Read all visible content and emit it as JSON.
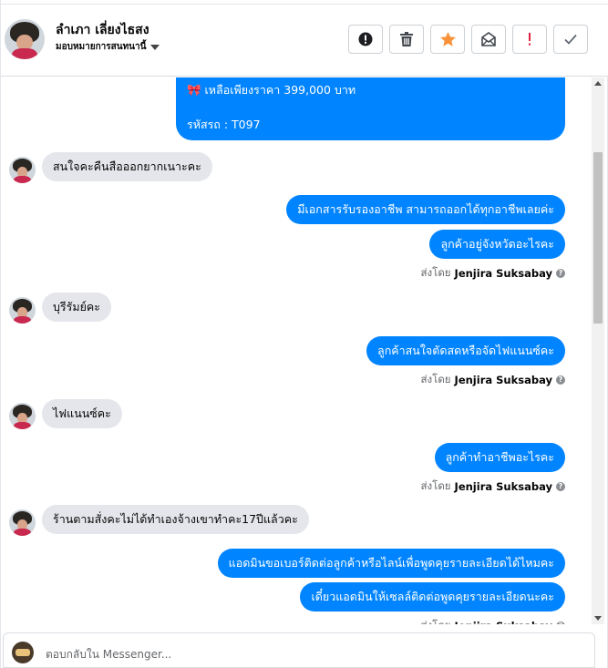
{
  "header": {
    "contact_name": "ลำเภา เลี่ยงไธสง",
    "assignment_label": "มอบหมายการสนทนานี้"
  },
  "toolbar": {
    "icons": [
      "alert-circle-icon",
      "trash-icon",
      "star-icon",
      "mail-icon",
      "exclamation-icon",
      "check-icon"
    ],
    "colors": {
      "star": "#f7923a",
      "exclamation": "#e41e3f",
      "icon": "#444950"
    }
  },
  "messages": [
    {
      "dir": "out",
      "lines": [
        "🎀 เหลือเพียงราคา 399,000 บาท",
        "",
        "รหัสรถ : T097"
      ]
    },
    {
      "dir": "in",
      "text": "สนใจคะคืนสือออกยากเนาะคะ"
    },
    {
      "dir": "out",
      "text": "มีเอกสารรับรองอาชีพ สามารถออกได้ทุกอาชีพเลยค่ะ"
    },
    {
      "dir": "out",
      "text": "ลูกค้าอยู่จังหวัดอะไรคะ"
    },
    {
      "dir": "in",
      "text": "บุรีรัมย์คะ"
    },
    {
      "dir": "out",
      "text": "ลูกค้าสนใจตัดสดหรือจัดไฟแนนซ์คะ"
    },
    {
      "dir": "in",
      "text": "ไฟแนนซ์คะ"
    },
    {
      "dir": "out",
      "text": "ลูกค้าทำอาชีพอะไรคะ"
    },
    {
      "dir": "in",
      "text": "ร้านตามสั่งคะไม่ได้ทำเองจ้างเขาทำคะ17ปีแล้วคะ"
    },
    {
      "dir": "out",
      "text": "แอดมินขอเบอร์ติดต่อลูกค้าหรือไลน์เพื่อพูดคุยรายละเอียดได้ไหมคะ"
    },
    {
      "dir": "out",
      "text": "เดี๋ยวแอดมินให้เซลล์ติดต่อพูดคุยรายละเอียดนะคะ"
    }
  ],
  "sent_by": {
    "prefix": "ส่งโดย",
    "agent": "Jenjira Suksabay",
    "help_icon": "?"
  },
  "composer": {
    "placeholder": "ตอบกลับใน Messenger..."
  },
  "colors": {
    "outgoing_bubble": "#0084ff",
    "incoming_bubble": "#e4e6eb"
  }
}
